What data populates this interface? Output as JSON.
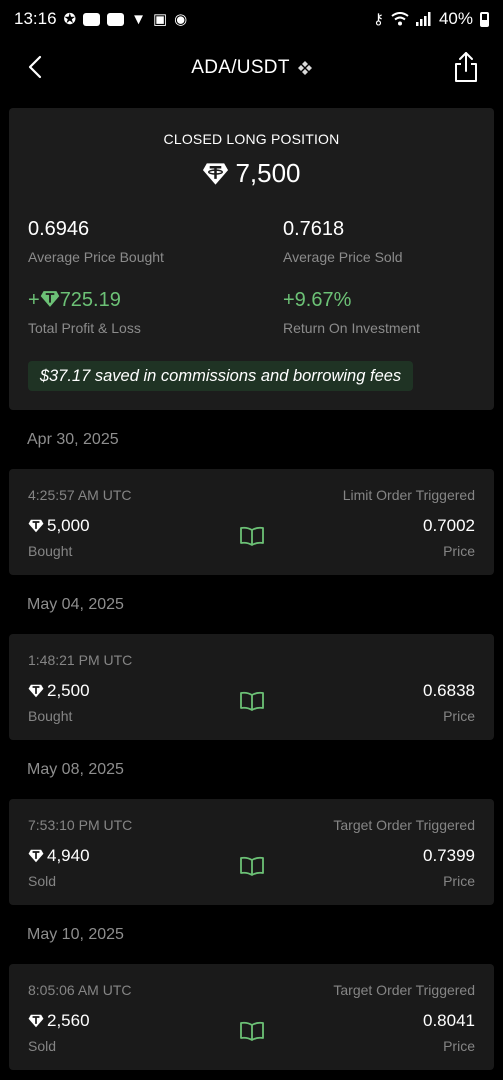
{
  "status_bar": {
    "time": "13:16",
    "battery": "40%"
  },
  "header": {
    "title": "ADA/USDT"
  },
  "summary": {
    "position_label": "CLOSED LONG POSITION",
    "amount": "7,500",
    "avg_bought_value": "0.6946",
    "avg_bought_label": "Average Price Bought",
    "avg_sold_value": "0.7618",
    "avg_sold_label": "Average Price Sold",
    "pnl_sign": "+",
    "pnl_value": "725.19",
    "pnl_label": "Total Profit & Loss",
    "roi_value": "+9.67%",
    "roi_label": "Return On Investment",
    "savings": "$37.17 saved in commissions and borrowing fees"
  },
  "orders": [
    {
      "date": "Apr 30, 2025",
      "time": "4:25:57 AM UTC",
      "status": "Limit Order Triggered",
      "amount": "5,000",
      "side": "Bought",
      "price": "0.7002",
      "price_label": "Price"
    },
    {
      "date": "May 04, 2025",
      "time": "1:48:21 PM UTC",
      "status": "",
      "amount": "2,500",
      "side": "Bought",
      "price": "0.6838",
      "price_label": "Price"
    },
    {
      "date": "May 08, 2025",
      "time": "7:53:10 PM UTC",
      "status": "Target Order Triggered",
      "amount": "4,940",
      "side": "Sold",
      "price": "0.7399",
      "price_label": "Price"
    },
    {
      "date": "May 10, 2025",
      "time": "8:05:06 AM UTC",
      "status": "Target Order Triggered",
      "amount": "2,560",
      "side": "Sold",
      "price": "0.8041",
      "price_label": "Price"
    }
  ],
  "colors": {
    "accent_green": "#6cc176",
    "card_bg": "#1c1c1c",
    "muted_text": "#8b8b8b"
  }
}
